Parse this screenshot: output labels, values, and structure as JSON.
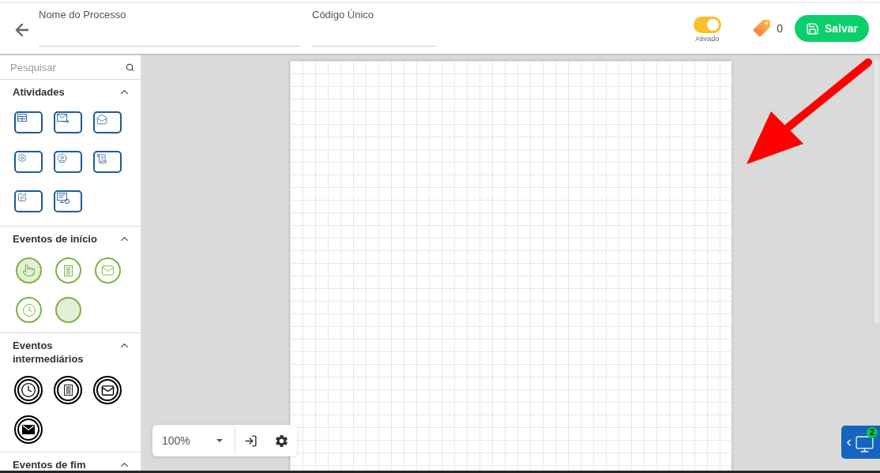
{
  "header": {
    "fields": [
      {
        "label": "Nome do Processo"
      },
      {
        "label": "Código Único"
      }
    ],
    "toggle": {
      "label": "Ativado",
      "on": true
    },
    "tag_count": "0",
    "save_button": "Salvar"
  },
  "sidebar": {
    "search": {
      "placeholder": "Pesquisar"
    },
    "sections": [
      {
        "title": "Atividades",
        "kind": "task",
        "expanded": true,
        "items": [
          {
            "kind": "table"
          },
          {
            "kind": "send"
          },
          {
            "kind": "receive"
          },
          {
            "kind": "service"
          },
          {
            "kind": "user"
          },
          {
            "kind": "script"
          },
          {
            "kind": "manual"
          },
          {
            "kind": "automation"
          }
        ]
      },
      {
        "title": "Eventos de início",
        "kind": "start",
        "expanded": true,
        "items": [
          {
            "kind": "touch"
          },
          {
            "kind": "document"
          },
          {
            "kind": "message"
          },
          {
            "kind": "timer"
          },
          {
            "kind": "none"
          }
        ]
      },
      {
        "title": "Eventos intermediários",
        "kind": "intermediate",
        "expanded": true,
        "items": [
          {
            "kind": "timer"
          },
          {
            "kind": "document"
          },
          {
            "kind": "message"
          },
          {
            "kind": "message_throw"
          }
        ]
      },
      {
        "title": "Eventos de fim",
        "kind": "end",
        "expanded": true
      }
    ]
  },
  "canvas": {
    "zoom": "100%"
  },
  "remote_panel": {
    "badge": "2"
  }
}
